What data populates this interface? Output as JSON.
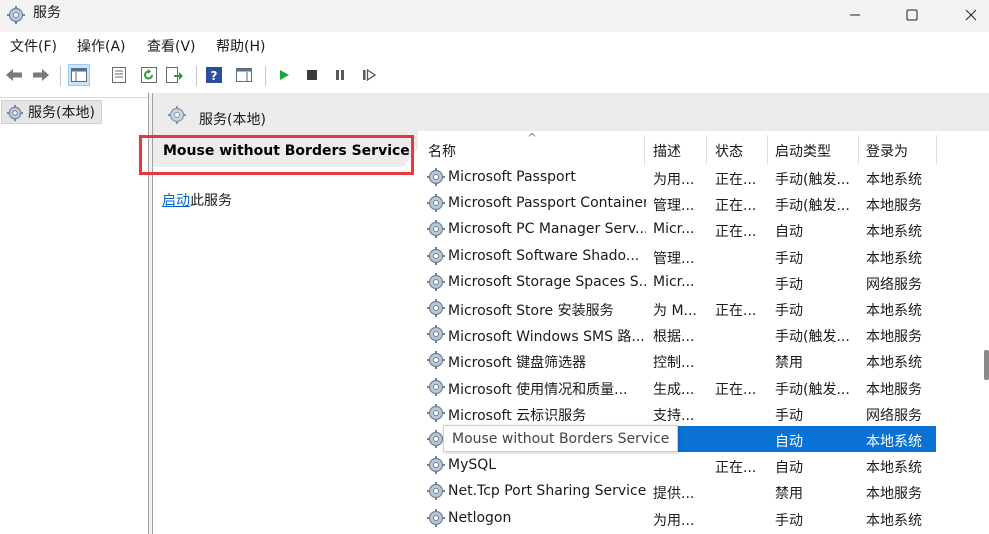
{
  "window": {
    "title": "服务",
    "app_icon": "gear-icon",
    "controls": [
      "minimize-icon",
      "maximize-icon",
      "close-icon"
    ]
  },
  "menu": [
    "文件(F)",
    "操作(A)",
    "查看(V)",
    "帮助(H)"
  ],
  "toolbar": {
    "buttons": [
      "back-icon",
      "forward-icon",
      "show-tree-icon",
      "properties-icon",
      "refresh-icon",
      "export-icon",
      "help-icon",
      "action-pane-icon",
      "play-icon",
      "stop-icon",
      "pause-icon",
      "resume-icon"
    ],
    "active": "show-tree-icon"
  },
  "tree": {
    "root_label": "服务(本地)"
  },
  "content": {
    "header_title": "服务(本地)",
    "selected_service": "Mouse without Borders Service",
    "start_link": "启动",
    "start_suffix": "此服务"
  },
  "columns": [
    "名称",
    "描述",
    "状态",
    "启动类型",
    "登录为"
  ],
  "rows": [
    {
      "name": "Microsoft Passport",
      "desc": "为用...",
      "status": "正在...",
      "startup": "手动(触发...",
      "logon": "本地系统"
    },
    {
      "name": "Microsoft Passport Container",
      "desc": "管理...",
      "status": "正在...",
      "startup": "手动(触发...",
      "logon": "本地服务"
    },
    {
      "name": "Microsoft PC Manager Serv...",
      "desc": "Micr...",
      "status": "正在...",
      "startup": "自动",
      "logon": "本地系统"
    },
    {
      "name": "Microsoft Software Shado...",
      "desc": "管理...",
      "status": "",
      "startup": "手动",
      "logon": "本地系统"
    },
    {
      "name": "Microsoft Storage Spaces S...",
      "desc": "Micr...",
      "status": "",
      "startup": "手动",
      "logon": "网络服务"
    },
    {
      "name": "Microsoft Store 安装服务",
      "desc": "为 M...",
      "status": "正在...",
      "startup": "手动",
      "logon": "本地系统"
    },
    {
      "name": "Microsoft Windows SMS 路...",
      "desc": "根据...",
      "status": "",
      "startup": "手动(触发...",
      "logon": "本地服务"
    },
    {
      "name": "Microsoft 键盘筛选器",
      "desc": "控制...",
      "status": "",
      "startup": "禁用",
      "logon": "本地系统"
    },
    {
      "name": "Microsoft 使用情况和质量...",
      "desc": "生成...",
      "status": "正在...",
      "startup": "手动(触发...",
      "logon": "本地服务"
    },
    {
      "name": "Microsoft 云标识服务",
      "desc": "支持...",
      "status": "",
      "startup": "手动",
      "logon": "网络服务"
    },
    {
      "name": "Mouse without Borders Service",
      "desc": "",
      "status": "",
      "startup": "自动",
      "logon": "本地系统",
      "selected": true
    },
    {
      "name": "MySQL",
      "desc": "",
      "status": "正在...",
      "startup": "自动",
      "logon": "本地系统"
    },
    {
      "name": "Net.Tcp Port Sharing Service",
      "desc": "提供...",
      "status": "",
      "startup": "禁用",
      "logon": "本地服务"
    },
    {
      "name": "Netlogon",
      "desc": "为用...",
      "status": "",
      "startup": "手动",
      "logon": "本地系统"
    }
  ],
  "colors": {
    "selection": "#0a72d4",
    "highlight_box": "#e8383d",
    "link": "#0066cc"
  }
}
